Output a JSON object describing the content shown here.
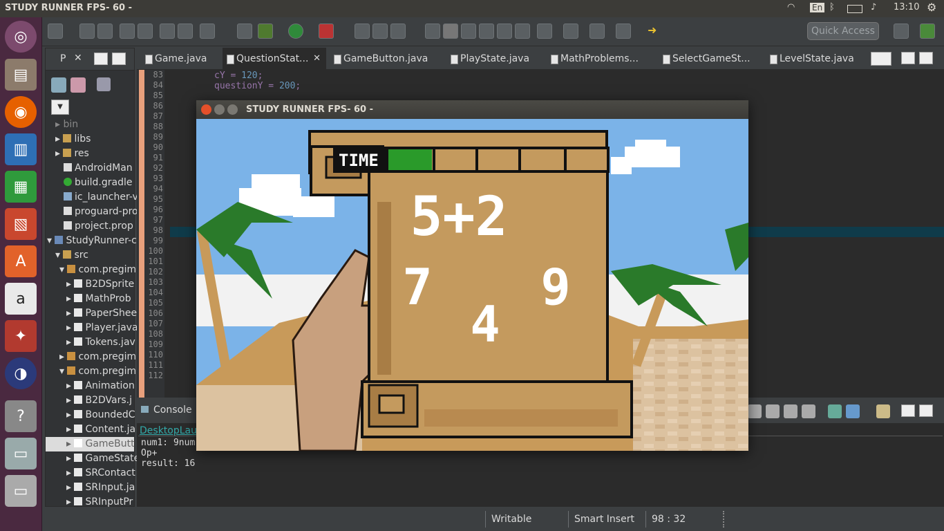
{
  "topbar": {
    "title": "STUDY RUNNER  FPS- 60 -",
    "keyboard": "En",
    "clock": "13:10"
  },
  "toolbar": {
    "quick_access_placeholder": "Quick Access"
  },
  "package_explorer": {
    "tab_label": "P",
    "items": [
      {
        "label": "bin"
      },
      {
        "label": "libs"
      },
      {
        "label": "res"
      },
      {
        "label": "AndroidMan"
      },
      {
        "label": "build.gradle"
      },
      {
        "label": "ic_launcher-v"
      },
      {
        "label": "proguard-pro"
      },
      {
        "label": "project.prop"
      },
      {
        "label": "StudyRunner-c"
      },
      {
        "label": "src"
      },
      {
        "label": "com.pregim"
      },
      {
        "label": "B2DSprite"
      },
      {
        "label": "MathProb"
      },
      {
        "label": "PaperShee"
      },
      {
        "label": "Player.java"
      },
      {
        "label": "Tokens.jav"
      },
      {
        "label": "com.pregim"
      },
      {
        "label": "com.pregim"
      },
      {
        "label": "Animation"
      },
      {
        "label": "B2DVars.j"
      },
      {
        "label": "BoundedC"
      },
      {
        "label": "Content.ja"
      },
      {
        "label": "GameButt"
      },
      {
        "label": "GameState"
      },
      {
        "label": "SRContact"
      },
      {
        "label": "SRInput.ja"
      },
      {
        "label": "SRInputPr"
      }
    ]
  },
  "editor": {
    "tabs": [
      {
        "label": "Game.java"
      },
      {
        "label": "QuestionStat..."
      },
      {
        "label": "GameButton.java"
      },
      {
        "label": "PlayState.java"
      },
      {
        "label": "MathProblems..."
      },
      {
        "label": "SelectGameSt..."
      },
      {
        "label": "LevelState.java"
      }
    ],
    "line_numbers": [
      "83",
      "84",
      "85",
      "86",
      "87",
      "88",
      "89",
      "90",
      "91",
      "92",
      "93",
      "94",
      "95",
      "96",
      "97",
      "98",
      "99",
      "100",
      "101",
      "102",
      "103",
      "104",
      "105",
      "106",
      "107",
      "108",
      "109",
      "110",
      "111",
      "112"
    ],
    "code_line_1_var": "cY",
    "code_line_1_val": "120",
    "code_line_2_var": "questionY",
    "code_line_2_val": "200"
  },
  "console": {
    "tab_label": "Console",
    "launcher": "DesktopLau",
    "lines": [
      "num1: 9num",
      "Op+",
      "result: 16"
    ]
  },
  "statusbar": {
    "mode": "Writable",
    "insert": "Smart Insert",
    "position": "98 : 32"
  },
  "game_window": {
    "title": "STUDY RUNNER  FPS- 60 -",
    "time_label": "TIME",
    "time_progress": 0.2,
    "question": "5+2",
    "answers": [
      "7",
      "4",
      "9"
    ],
    "colors": {
      "sky": "#7bb3e8",
      "paper": "#c49a5e",
      "paper_dark": "#a87d45",
      "timer": "#2a9a2a"
    }
  }
}
